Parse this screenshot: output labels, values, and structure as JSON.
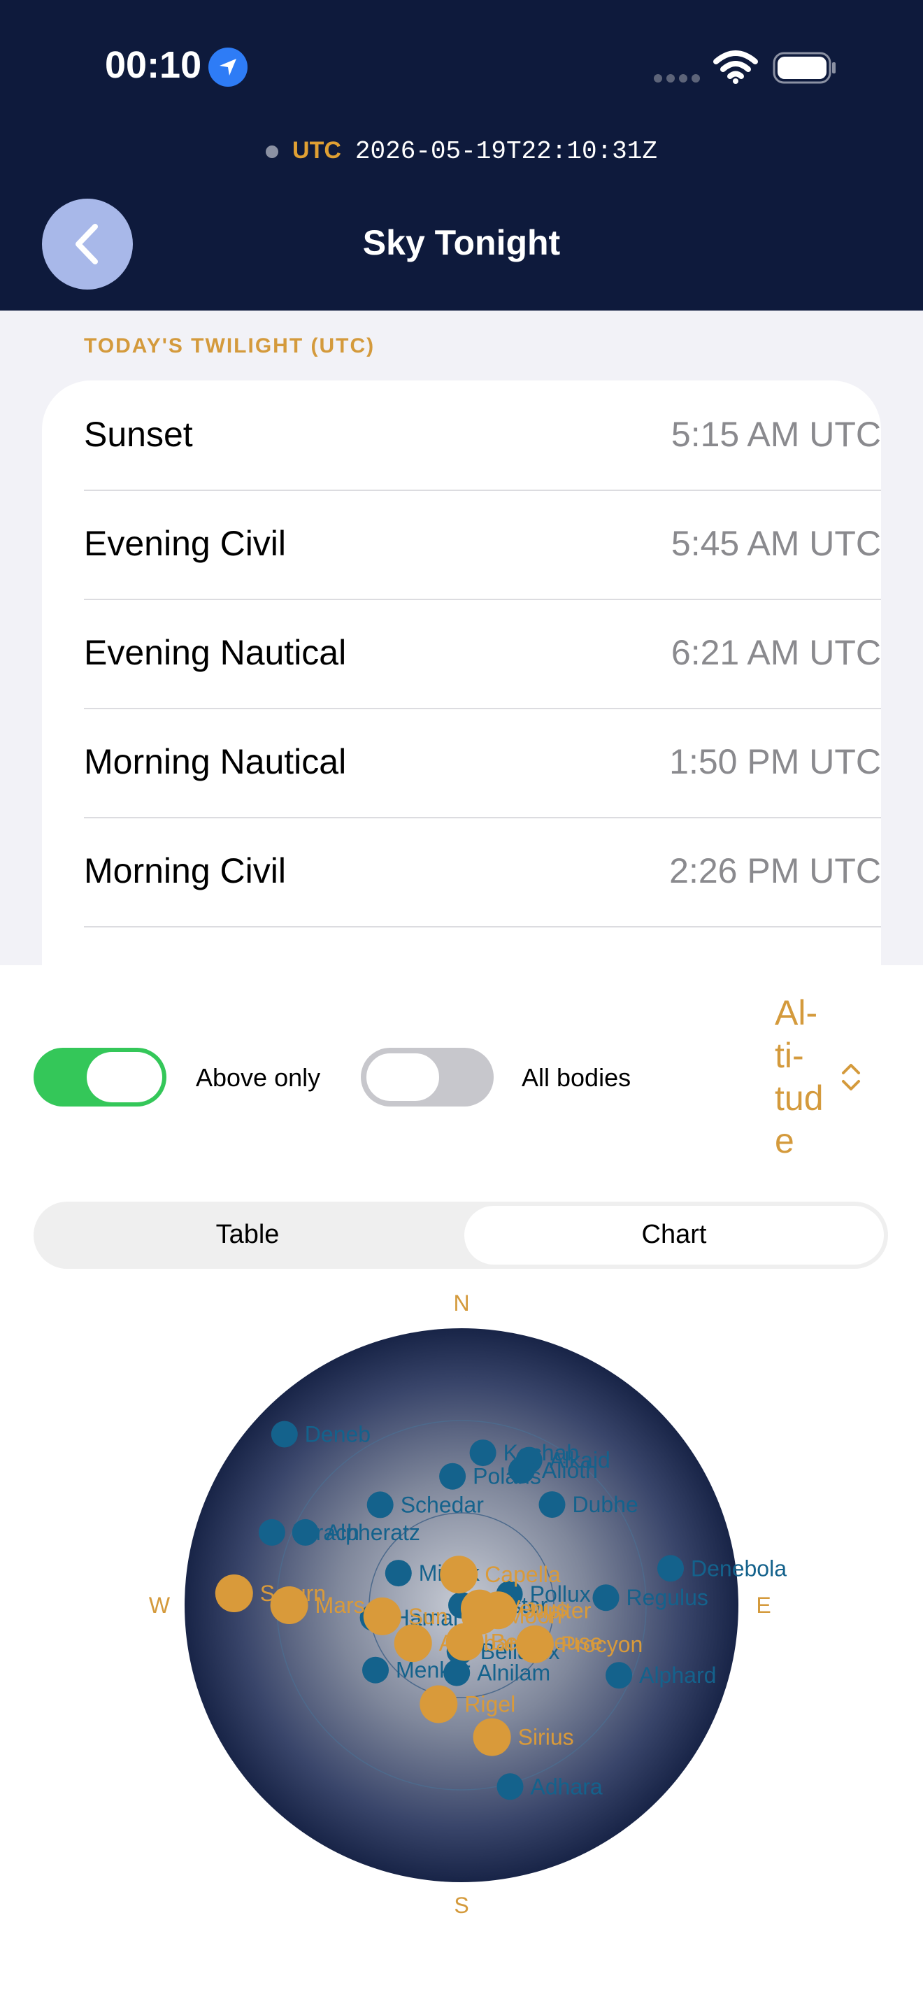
{
  "status_bar": {
    "time": "00:10",
    "icons": [
      "location-arrow-icon",
      "cell-signal-icon",
      "wifi-icon",
      "battery-icon"
    ]
  },
  "header": {
    "utc_label": "UTC",
    "utc_value": "2026-05-19T22:10:31Z",
    "title": "Sky Tonight",
    "back_icon": "chevron-left-icon"
  },
  "twilight": {
    "section_title": "TODAY'S TWILIGHT (UTC)",
    "rows": [
      {
        "label": "Sunset",
        "value": "5:15 AM UTC"
      },
      {
        "label": "Evening Civil",
        "value": "5:45 AM UTC"
      },
      {
        "label": "Evening Nautical",
        "value": "6:21 AM UTC"
      },
      {
        "label": "Morning Nautical",
        "value": "1:50 PM UTC"
      },
      {
        "label": "Morning Civil",
        "value": "2:26 PM UTC"
      }
    ]
  },
  "controls": {
    "above_only": {
      "label": "Above only",
      "on": true
    },
    "all_bodies": {
      "label": "All bodies",
      "on": false
    },
    "sort_label": "Al-\nti-\ntud\ne"
  },
  "segmented": {
    "options": [
      "Table",
      "Chart"
    ],
    "selected": "Chart"
  },
  "colors": {
    "header_bg": "#0e1a3c",
    "accent": "#d49a3c",
    "star": "#14628c",
    "planet": "#d99a3a",
    "toggle_on": "#34c759"
  },
  "chart_data": {
    "type": "scatter",
    "projection": "polar-altaz",
    "cardinals": {
      "north": "N",
      "south": "S",
      "east": "E",
      "west": "W"
    },
    "altitude_rings_deg": [
      30,
      60
    ],
    "stars": [
      {
        "name": "Deneb",
        "az": 314,
        "alt": 10
      },
      {
        "name": "Kochab",
        "az": 8,
        "alt": 40
      },
      {
        "name": "Alkaid",
        "az": 25,
        "alt": 38
      },
      {
        "name": "Alioth",
        "az": 24,
        "alt": 42
      },
      {
        "name": "Polaris",
        "az": 356,
        "alt": 48
      },
      {
        "name": "Dubhe",
        "az": 42,
        "alt": 46
      },
      {
        "name": "Schedar",
        "az": 321,
        "alt": 48
      },
      {
        "name": "Mirach",
        "az": 291,
        "alt": 24
      },
      {
        "name": "Alpheratz",
        "az": 295,
        "alt": 34
      },
      {
        "name": "Mirfak",
        "az": 297,
        "alt": 67
      },
      {
        "name": "Denebola",
        "az": 80,
        "alt": 21
      },
      {
        "name": "Hamal",
        "az": 262,
        "alt": 61
      },
      {
        "name": "Pollux",
        "az": 77,
        "alt": 74
      },
      {
        "name": "Castor",
        "az": 50,
        "alt": 90
      },
      {
        "name": "Regulus",
        "az": 87,
        "alt": 43
      },
      {
        "name": "Menkar",
        "az": 233,
        "alt": 55
      },
      {
        "name": "Bellatrix",
        "az": 182,
        "alt": 75
      },
      {
        "name": "Alnilam",
        "az": 184,
        "alt": 68
      },
      {
        "name": "Alphard",
        "az": 114,
        "alt": 34
      },
      {
        "name": "Adhara",
        "az": 165,
        "alt": 29
      }
    ],
    "planets": [
      {
        "name": "Capella",
        "az": 355,
        "alt": 80
      },
      {
        "name": "Saturn",
        "az": 273,
        "alt": 16
      },
      {
        "name": "Mars",
        "az": 270,
        "alt": 34
      },
      {
        "name": "Sun",
        "az": 262,
        "alt": 64
      },
      {
        "name": "Aldebaran",
        "az": 232,
        "alt": 70
      },
      {
        "name": "Moon",
        "az": 119,
        "alt": 83
      },
      {
        "name": "Venus",
        "az": 100,
        "alt": 84
      },
      {
        "name": "Jupiter",
        "az": 98,
        "alt": 78
      },
      {
        "name": "Betelgeuse",
        "az": 175,
        "alt": 78
      },
      {
        "name": "Procyon",
        "az": 118,
        "alt": 63
      },
      {
        "name": "Rigel",
        "az": 193,
        "alt": 57
      },
      {
        "name": "Sirius",
        "az": 167,
        "alt": 46
      }
    ]
  }
}
